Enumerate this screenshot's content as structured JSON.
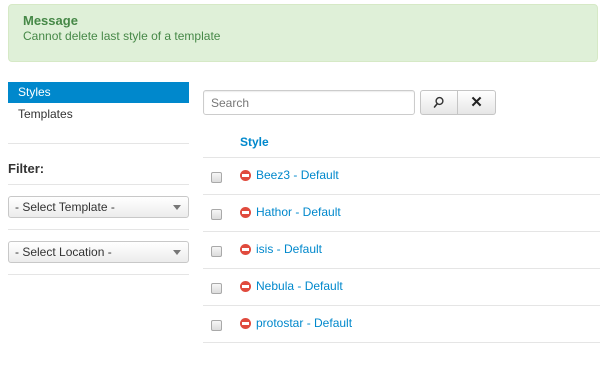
{
  "message": {
    "heading": "Message",
    "text": "Cannot delete last style of a template"
  },
  "sidebar": {
    "items": [
      {
        "label": "Styles",
        "active": true
      },
      {
        "label": "Templates",
        "active": false
      }
    ],
    "filter_label": "Filter:",
    "selects": [
      {
        "value": "- Select Template -"
      },
      {
        "value": "- Select Location -"
      }
    ]
  },
  "search": {
    "placeholder": "Search",
    "value": "",
    "search_icon": "search-icon",
    "clear_icon": "close-icon"
  },
  "table": {
    "header": "Style",
    "rows": [
      {
        "label": "Beez3 - Default",
        "status": "unpublished"
      },
      {
        "label": "Hathor - Default",
        "status": "unpublished"
      },
      {
        "label": "isis - Default",
        "status": "unpublished"
      },
      {
        "label": "Nebula - Default",
        "status": "unpublished"
      },
      {
        "label": "protostar - Default",
        "status": "unpublished"
      }
    ]
  },
  "colors": {
    "accent": "#0088cc",
    "success_bg": "#dff0d8",
    "success_text": "#468847",
    "status_red": "#e04a3d"
  }
}
